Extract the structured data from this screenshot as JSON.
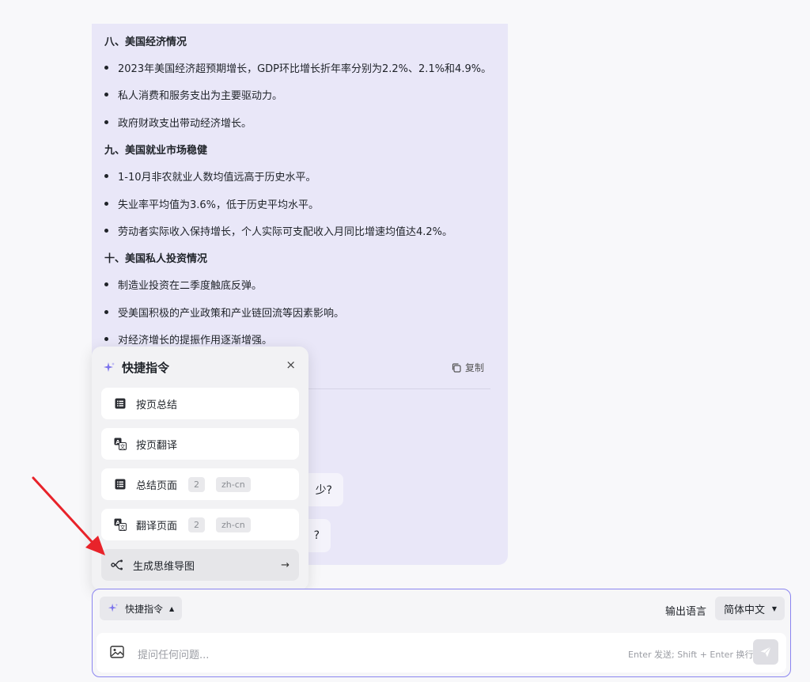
{
  "answer": {
    "sections": [
      {
        "title": "八、美国经济情况",
        "items": [
          "2023年美国经济超预期增长，GDP环比增长折年率分别为2.2%、2.1%和4.9%。",
          "私人消费和服务支出为主要驱动力。",
          "政府财政支出带动经济增长。"
        ]
      },
      {
        "title": "九、美国就业市场稳健",
        "items": [
          "1-10月非农就业人数均值远高于历史水平。",
          "失业率平均值为3.6%，低于历史平均水平。",
          "劳动者实际收入保持增长，个人实际可支配收入月同比增速均值达4.2%。"
        ]
      },
      {
        "title": "十、美国私人投资情况",
        "items": [
          "制造业投资在二季度触底反弹。",
          "受美国积极的产业政策和产业链回流等因素影响。",
          "对经济增长的提振作用逐渐增强。"
        ]
      }
    ],
    "copy_label": "复制",
    "suggestions": [
      "少?",
      "?"
    ]
  },
  "popup": {
    "title": "快捷指令",
    "close": "×",
    "commands": [
      {
        "label": "按页总结",
        "icon": "list-icon"
      },
      {
        "label": "按页翻译",
        "icon": "translate-icon"
      },
      {
        "label": "总结页面",
        "icon": "list-icon",
        "tags": [
          "2",
          "zh-cn"
        ]
      },
      {
        "label": "翻译页面",
        "icon": "translate-icon",
        "tags": [
          "2",
          "zh-cn"
        ]
      },
      {
        "label": "生成思维导图",
        "icon": "mindmap-icon",
        "arrow": "→"
      }
    ]
  },
  "input": {
    "quick_command_label": "快捷指令",
    "output_language_label": "输出语言",
    "language_value": "简体中文",
    "placeholder": "提问任何问题...",
    "hint": "Enter 发送; Shift + Enter 换行"
  },
  "colors": {
    "card_bg": "#e9e7f8",
    "accent": "#8b85f0",
    "annotation_arrow": "#e8232a"
  }
}
